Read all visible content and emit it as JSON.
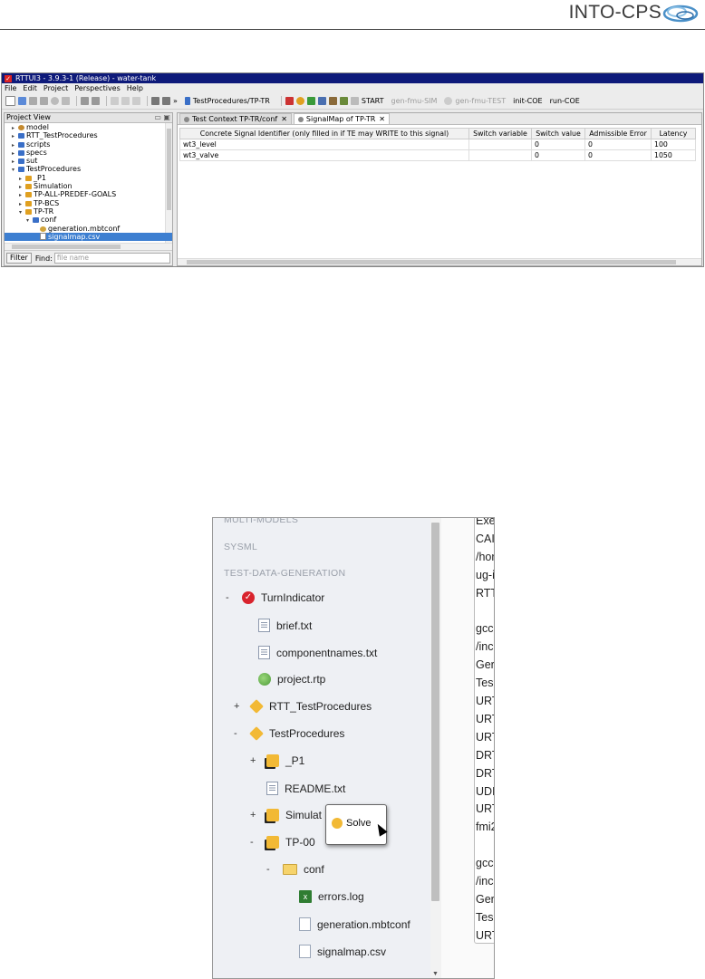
{
  "header": {
    "logo_text": "INTO-CPS"
  },
  "rttui": {
    "window_title": "RTTUI3 - 3.9.3-1 (Release) - water-tank",
    "menu": [
      "File",
      "Edit",
      "Project",
      "Perspectives",
      "Help"
    ],
    "toolbar": {
      "procedure": "TestProcedures/TP-TR",
      "start": "START",
      "gen_sim": "gen-fmu-SIM",
      "gen_test": "gen-fmu-TEST",
      "init_coe": "init-COE",
      "run_coe": "run-COE"
    },
    "project_view": {
      "title": "Project View",
      "tree": [
        {
          "label": "model",
          "arrow": "▸",
          "icon": "model",
          "indent": 1
        },
        {
          "label": "RTT_TestProcedures",
          "arrow": "▸",
          "icon": "folder",
          "indent": 1
        },
        {
          "label": "scripts",
          "arrow": "▸",
          "icon": "folder",
          "indent": 1
        },
        {
          "label": "specs",
          "arrow": "▸",
          "icon": "folder",
          "indent": 1
        },
        {
          "label": "sut",
          "arrow": "▸",
          "icon": "folder",
          "indent": 1
        },
        {
          "label": "TestProcedures",
          "arrow": "▾",
          "icon": "folder",
          "indent": 1
        },
        {
          "label": "_P1",
          "arrow": "▸",
          "icon": "pkg",
          "indent": 2
        },
        {
          "label": "Simulation",
          "arrow": "▸",
          "icon": "pkg",
          "indent": 2
        },
        {
          "label": "TP-ALL-PREDEF-GOALS",
          "arrow": "▸",
          "icon": "pkg",
          "indent": 2
        },
        {
          "label": "TP-BCS",
          "arrow": "▸",
          "icon": "pkg",
          "indent": 2
        },
        {
          "label": "TP-TR",
          "arrow": "▾",
          "icon": "pkg",
          "indent": 2
        },
        {
          "label": "conf",
          "arrow": "▾",
          "icon": "folder",
          "indent": 3
        },
        {
          "label": "generation.mbtconf",
          "arrow": "",
          "icon": "mbt",
          "indent": 4
        },
        {
          "label": "signalmap.csv",
          "arrow": "",
          "icon": "file",
          "indent": 4,
          "selected": true
        }
      ],
      "filter_label": "Filter",
      "find_label": "Find:",
      "find_placeholder": "file name"
    },
    "tabs": [
      {
        "label": "Test Context TP-TR/conf",
        "active": false
      },
      {
        "label": "SignalMap of TP-TR",
        "active": true
      }
    ],
    "table": {
      "columns": [
        "Concrete Signal Identifier (only filled in if TE may WRITE to this signal)",
        "Switch variable",
        "Switch value",
        "Admissible Error",
        "Latency"
      ],
      "rows": [
        [
          "wt3_level",
          "",
          "0",
          "0",
          "100"
        ],
        [
          "wt3_valve",
          "",
          "0",
          "0",
          "1050"
        ]
      ]
    }
  },
  "intocps": {
    "sections": [
      "MULTI-MODELS",
      "SYSML",
      "TEST-DATA-GENERATION"
    ],
    "tree": [
      {
        "toggle": "-",
        "icon": "check",
        "label": "TurnIndicator",
        "level": 0
      },
      {
        "toggle": "",
        "icon": "doc",
        "label": "brief.txt",
        "level": 1
      },
      {
        "toggle": "",
        "icon": "doc",
        "label": "componentnames.txt",
        "level": 1
      },
      {
        "toggle": "",
        "icon": "globe",
        "label": "project.rtp",
        "level": 1
      },
      {
        "toggle": "+",
        "icon": "pkg",
        "label": "RTT_TestProcedures",
        "level": 0.5
      },
      {
        "toggle": "-",
        "icon": "pkg",
        "label": "TestProcedures",
        "level": 0.5
      },
      {
        "toggle": "+",
        "icon": "pkgd",
        "label": "_P1",
        "level": 1.5
      },
      {
        "toggle": "",
        "icon": "doc",
        "label": "README.txt",
        "level": 1.5
      },
      {
        "toggle": "+",
        "icon": "pkgd",
        "label": "Simulat",
        "level": 1.5
      },
      {
        "toggle": "-",
        "icon": "pkgd",
        "label": "TP-00",
        "level": 1.5
      },
      {
        "toggle": "-",
        "icon": "folder",
        "label": "conf",
        "level": 2.5
      },
      {
        "toggle": "",
        "icon": "xls",
        "label": "errors.log",
        "level": 3.5
      },
      {
        "toggle": "",
        "icon": "plain",
        "label": "generation.mbtconf",
        "level": 3.5
      },
      {
        "toggle": "",
        "icon": "plain",
        "label": "signalmap.csv",
        "level": 3.5
      }
    ],
    "context_menu": {
      "item": "Solve"
    },
    "console_lines": [
      {
        "text": "Exe",
        "y": 0
      },
      {
        "text": "CAI",
        "y": 1
      },
      {
        "text": "/hor",
        "y": 2
      },
      {
        "text": "ug-i",
        "y": 3
      },
      {
        "text": "RTT",
        "y": 4
      },
      {
        "text": "gcc",
        "y": 6
      },
      {
        "text": "/inc",
        "y": 7
      },
      {
        "text": "Ger",
        "y": 8
      },
      {
        "text": "Tes",
        "y": 9
      },
      {
        "text": "URT",
        "y": 10
      },
      {
        "text": "URT",
        "y": 11
      },
      {
        "text": "URT",
        "y": 12
      },
      {
        "text": "DRT",
        "y": 13
      },
      {
        "text": "DRT",
        "y": 14
      },
      {
        "text": "UDI",
        "y": 15
      },
      {
        "text": "URT",
        "y": 16
      },
      {
        "text": "fmi2",
        "y": 17
      },
      {
        "text": "gcc",
        "y": 19
      },
      {
        "text": "/inc",
        "y": 20
      },
      {
        "text": "Ger",
        "y": 21
      },
      {
        "text": "Tes",
        "y": 22
      },
      {
        "text": "URT",
        "y": 23
      }
    ]
  }
}
